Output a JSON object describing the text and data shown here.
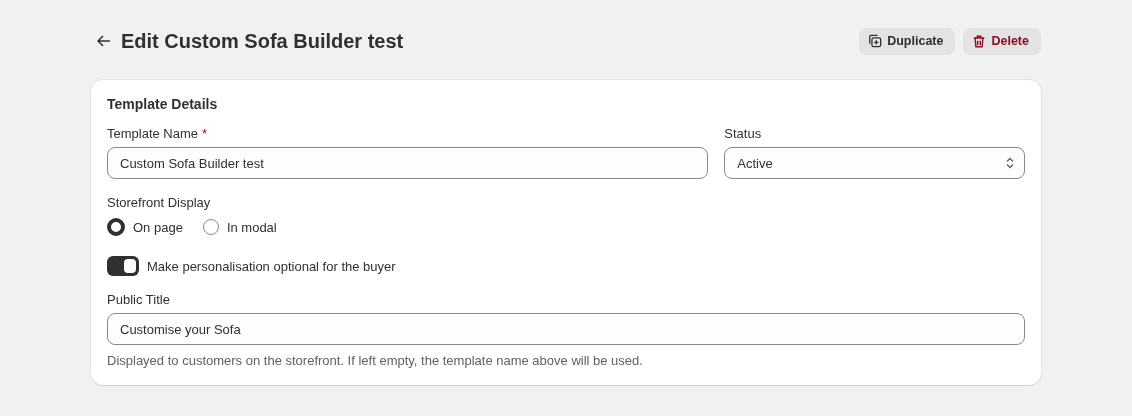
{
  "header": {
    "title": "Edit Custom Sofa Builder test",
    "actions": [
      {
        "kind": "duplicate",
        "label": "Duplicate"
      },
      {
        "kind": "delete",
        "label": "Delete"
      }
    ]
  },
  "card": {
    "title": "Template Details",
    "template_name": {
      "label": "Template Name",
      "required_mark": "*",
      "value": "Custom Sofa Builder test"
    },
    "status": {
      "label": "Status",
      "value": "Active"
    },
    "storefront_display": {
      "label": "Storefront Display",
      "options": [
        {
          "label": "On page",
          "selected": true
        },
        {
          "label": "In modal",
          "selected": false
        }
      ]
    },
    "personalisation_toggle": {
      "label": "Make personalisation optional for the buyer",
      "on": true
    },
    "public_title": {
      "label": "Public Title",
      "value": "Customise your Sofa",
      "help": "Displayed to customers on the storefront. If left empty, the template name above will be used."
    }
  }
}
